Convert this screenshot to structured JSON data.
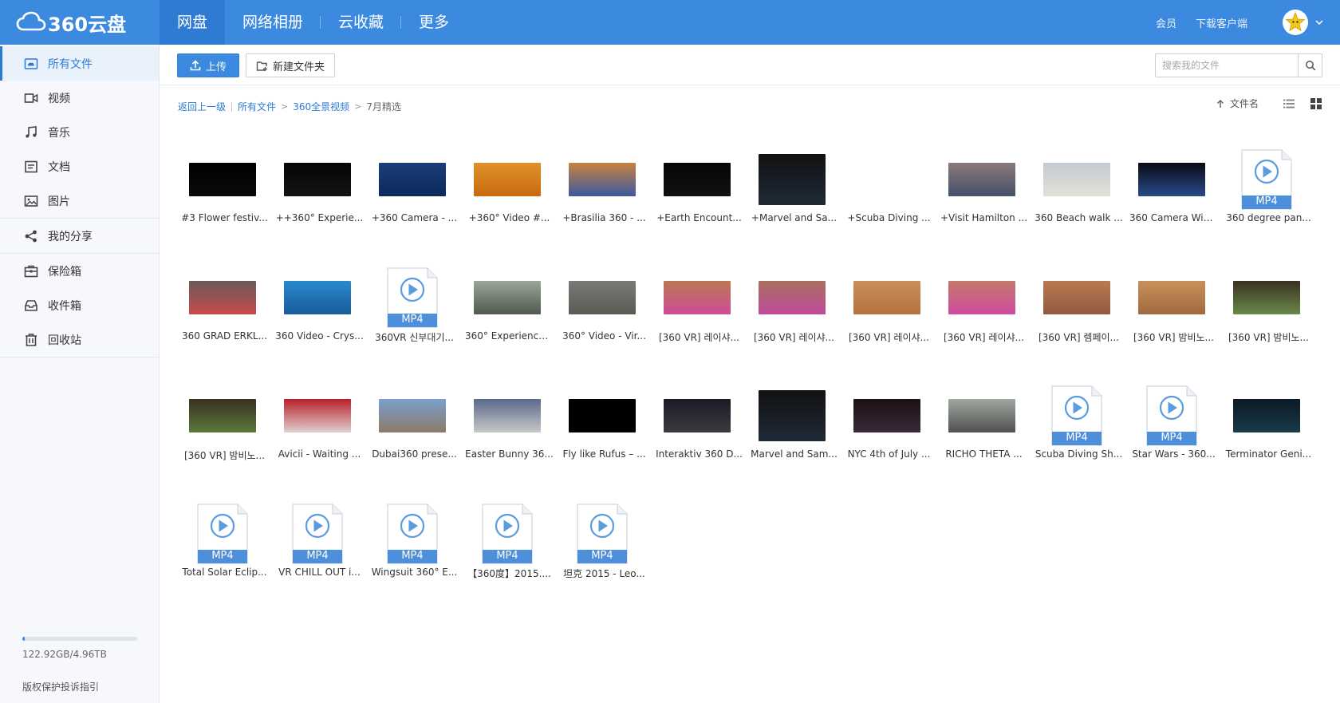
{
  "app": {
    "logo_text": "360云盘",
    "topnav": [
      "网盘",
      "网络相册",
      "云收藏",
      "更多"
    ],
    "topnav_active": 0,
    "topright": {
      "member": "会员",
      "download_client": "下载客户端"
    }
  },
  "sidebar": {
    "items": [
      {
        "label": "所有文件",
        "icon": "cloud-folder-icon"
      },
      {
        "label": "视频",
        "icon": "video-camera-icon"
      },
      {
        "label": "音乐",
        "icon": "music-note-icon"
      },
      {
        "label": "文档",
        "icon": "document-icon"
      },
      {
        "label": "图片",
        "icon": "image-icon"
      },
      {
        "label": "我的分享",
        "icon": "share-icon"
      },
      {
        "label": "保险箱",
        "icon": "safe-box-icon"
      },
      {
        "label": "收件箱",
        "icon": "inbox-icon"
      },
      {
        "label": "回收站",
        "icon": "trash-icon"
      }
    ],
    "active": 0,
    "storage": {
      "text": "122.92GB/4.96TB",
      "used_fraction": 0.024
    },
    "copyright_link": "版权保护投诉指引"
  },
  "toolbar": {
    "upload_label": "上传",
    "new_folder_label": "新建文件夹",
    "search_placeholder": "搜索我的文件"
  },
  "breadcrumb": {
    "back": "返回上一级",
    "path": [
      "所有文件",
      "360全景视频"
    ],
    "current": "7月精选"
  },
  "sort": {
    "label": "文件名"
  },
  "files": [
    {
      "name": "#3 Flower festiv...",
      "thumb": [
        "#000000",
        "#0a0a0a"
      ],
      "kind": "wide"
    },
    {
      "name": "++360° Experie...",
      "thumb": [
        "#050505",
        "#141414"
      ],
      "kind": "wide"
    },
    {
      "name": "+360 Camera - ...",
      "thumb": [
        "#1a3d7a",
        "#0c2a5a"
      ],
      "kind": "wide"
    },
    {
      "name": "+360° Video #...",
      "thumb": [
        "#e0912a",
        "#c86a10"
      ],
      "kind": "wide"
    },
    {
      "name": "+Brasilia 360 - ...",
      "thumb": [
        "#c88240",
        "#3a5aa0"
      ],
      "kind": "wide"
    },
    {
      "name": "+Earth Encount...",
      "thumb": [
        "#050505",
        "#111111"
      ],
      "kind": "wide"
    },
    {
      "name": "+Marvel and Sa...",
      "thumb": [
        "#111111",
        "#202a38"
      ],
      "kind": "square"
    },
    {
      "name": "+Scuba Diving ...",
      "thumb": [],
      "kind": "none"
    },
    {
      "name": "+Visit Hamilton ...",
      "thumb": [
        "#8a7a7a",
        "#44506a"
      ],
      "kind": "wide"
    },
    {
      "name": "360 Beach walk ...",
      "thumb": [
        "#c4cbd4",
        "#e4e0d6"
      ],
      "kind": "wide"
    },
    {
      "name": "360 Camera Win...",
      "thumb": [
        "#0a0a14",
        "#2a4a8a"
      ],
      "kind": "wide"
    },
    {
      "name": "360 degree pan...",
      "thumb": [],
      "kind": "mp4"
    },
    {
      "name": "360 GRAD ERKL...",
      "thumb": [
        "#6a5a5a",
        "#c84a4a"
      ],
      "kind": "wide"
    },
    {
      "name": "360 Video - Crys...",
      "thumb": [
        "#2a8acc",
        "#1a5a9a"
      ],
      "kind": "wide"
    },
    {
      "name": "360VR 신부대기...",
      "thumb": [],
      "kind": "mp4"
    },
    {
      "name": "360° Experience...",
      "thumb": [
        "#9aa69a",
        "#505a50"
      ],
      "kind": "wide"
    },
    {
      "name": "360° Video - Vir...",
      "thumb": [
        "#7a7a76",
        "#5a5a55"
      ],
      "kind": "wide"
    },
    {
      "name": "[360 VR] 레이샤...",
      "thumb": [
        "#b87a50",
        "#d04a9a"
      ],
      "kind": "wide"
    },
    {
      "name": "[360 VR] 레이샤...",
      "thumb": [
        "#a87060",
        "#c04a9a"
      ],
      "kind": "wide"
    },
    {
      "name": "[360 VR] 레이샤...",
      "thumb": [
        "#c8905a",
        "#b87040"
      ],
      "kind": "wide"
    },
    {
      "name": "[360 VR] 레이샤...",
      "thumb": [
        "#c47a6a",
        "#d04aa0"
      ],
      "kind": "wide"
    },
    {
      "name": "[360 VR] 렘페이...",
      "thumb": [
        "#b87a50",
        "#905a40"
      ],
      "kind": "wide"
    },
    {
      "name": "[360 VR] 밤비노...",
      "thumb": [
        "#c8905a",
        "#a06a40"
      ],
      "kind": "wide"
    },
    {
      "name": "[360 VR] 밤비노...",
      "thumb": [
        "#3a3020",
        "#6a8a4a"
      ],
      "kind": "wide"
    },
    {
      "name": "[360 VR] 밤비노...",
      "thumb": [
        "#3a3020",
        "#5a7a3a"
      ],
      "kind": "wide"
    },
    {
      "name": "Avicii - Waiting ...",
      "thumb": [
        "#b8202a",
        "#e0d0d0"
      ],
      "kind": "wide"
    },
    {
      "name": "Dubai360 prese...",
      "thumb": [
        "#7aa0cc",
        "#8a7a6a"
      ],
      "kind": "wide"
    },
    {
      "name": "Easter Bunny 36...",
      "thumb": [
        "#5a6a8a",
        "#c8c8c8"
      ],
      "kind": "wide"
    },
    {
      "name": "Fly like Rufus – ...",
      "thumb": [
        "#000000",
        "#000000"
      ],
      "kind": "wide"
    },
    {
      "name": "Interaktiv 360 D...",
      "thumb": [
        "#1a1a24",
        "#3a3a40"
      ],
      "kind": "wide"
    },
    {
      "name": "Marvel and Sam...",
      "thumb": [
        "#111111",
        "#202a38"
      ],
      "kind": "square"
    },
    {
      "name": "NYC 4th of July ...",
      "thumb": [
        "#1a1014",
        "#3a2a3a"
      ],
      "kind": "wide"
    },
    {
      "name": "RICHO THETA ...",
      "thumb": [
        "#a0a8a0",
        "#505050"
      ],
      "kind": "wide"
    },
    {
      "name": "Scuba Diving Sh...",
      "thumb": [],
      "kind": "mp4"
    },
    {
      "name": "Star Wars - 360...",
      "thumb": [],
      "kind": "mp4"
    },
    {
      "name": "Terminator Geni...",
      "thumb": [
        "#0a1a24",
        "#1a3a4a"
      ],
      "kind": "wide"
    },
    {
      "name": "Total Solar Eclip...",
      "thumb": [],
      "kind": "mp4"
    },
    {
      "name": "VR CHILL OUT i...",
      "thumb": [],
      "kind": "mp4"
    },
    {
      "name": "Wingsuit 360° E...",
      "thumb": [],
      "kind": "mp4"
    },
    {
      "name": "【360度】2015....",
      "thumb": [],
      "kind": "mp4"
    },
    {
      "name": "坦克 2015 - Leo...",
      "thumb": [],
      "kind": "mp4"
    }
  ],
  "mp4_badge": "MP4",
  "colors": {
    "accent": "#3b8ae0",
    "link": "#2b7ad4"
  }
}
